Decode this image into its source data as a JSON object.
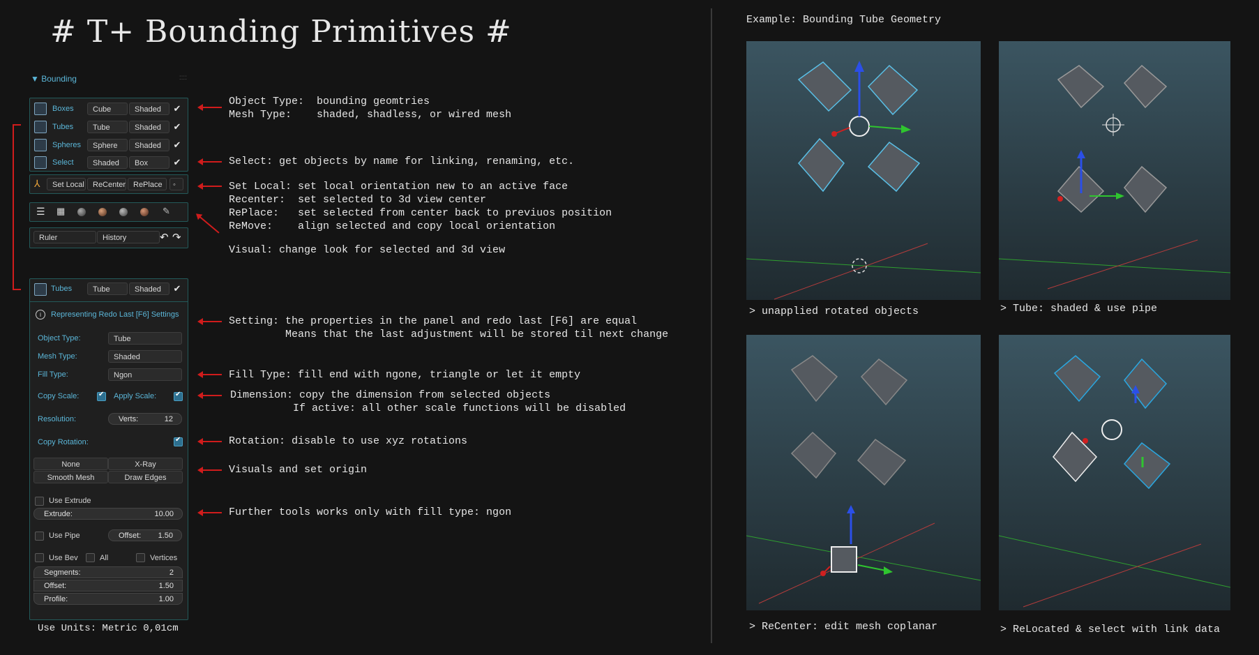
{
  "title": "# T+ Bounding Primitives #",
  "panel": {
    "header": "▼ Bounding",
    "grip": "::::",
    "rows": [
      {
        "label": "Boxes",
        "type": "Cube",
        "mesh": "Shaded"
      },
      {
        "label": "Tubes",
        "type": "Tube",
        "mesh": "Shaded"
      },
      {
        "label": "Spheres",
        "type": "Sphere",
        "mesh": "Shaded"
      },
      {
        "label": "Select",
        "type": "Shaded",
        "mesh": "Box"
      }
    ],
    "tools": {
      "set_local": "Set Local",
      "recenter": "ReCenter",
      "replace": "RePlace"
    },
    "ruler": "Ruler",
    "history": "History"
  },
  "redo": {
    "header_label": "Tubes",
    "header_type": "Tube",
    "header_mesh": "Shaded",
    "info": "Representing Redo Last [F6] Settings",
    "object_type_label": "Object Type:",
    "object_type": "Tube",
    "mesh_type_label": "Mesh Type:",
    "mesh_type": "Shaded",
    "fill_type_label": "Fill Type:",
    "fill_type": "Ngon",
    "copy_scale": "Copy Scale:",
    "apply_scale": "Apply Scale:",
    "resolution_label": "Resolution:",
    "verts_label": "Verts:",
    "verts": "12",
    "copy_rotation": "Copy Rotation:",
    "origin": "None",
    "xray": "X-Ray",
    "smooth": "Smooth Mesh",
    "draw_edges": "Draw Edges",
    "use_extrude": "Use Extrude",
    "extrude_label": "Extrude:",
    "extrude": "10.00",
    "use_pipe": "Use Pipe",
    "pipe_offset_label": "Offset:",
    "pipe_offset": "1.50",
    "use_bev": "Use Bev",
    "all": "All",
    "vertices": "Vertices",
    "segments_label": "Segments:",
    "segments": "2",
    "offset_label": "Offset:",
    "offset": "1.50",
    "profile_label": "Profile:",
    "profile": "1.00"
  },
  "units": "Use Units: Metric 0,01cm",
  "notes": {
    "object_type": "Object Type:  bounding geomtries\nMesh Type:    shaded, shadless, or wired mesh",
    "select": "Select: get objects by name for linking, renaming, etc.",
    "set_local": "Set Local: set local orientation new to an active face\nRecenter:  set selected to 3d view center\nRePlace:   set selected from center back to previuos position\nReMove:    align selected and copy local orientation",
    "visual": "Visual: change look for selected and 3d view",
    "setting": "Setting: the properties in the panel and redo last [F6] are equal\n         Means that the last adjustment will be stored til next change",
    "fill": "Fill Type: fill end with ngone, triangle or let it empty",
    "dimension": "Dimension: copy the dimension from selected objects\n          If active: all other scale functions will be disabled",
    "rotation": "Rotation: disable to use xyz rotations",
    "visuals": "Visuals and set origin",
    "further": "Further tools works only with fill type: ngon"
  },
  "example_title": "Example: Bounding Tube Geometry",
  "captions": [
    "> unapplied rotated objects",
    "> Tube: shaded & use pipe",
    "> ReCenter: edit mesh coplanar",
    "> ReLocated & select with link data"
  ]
}
